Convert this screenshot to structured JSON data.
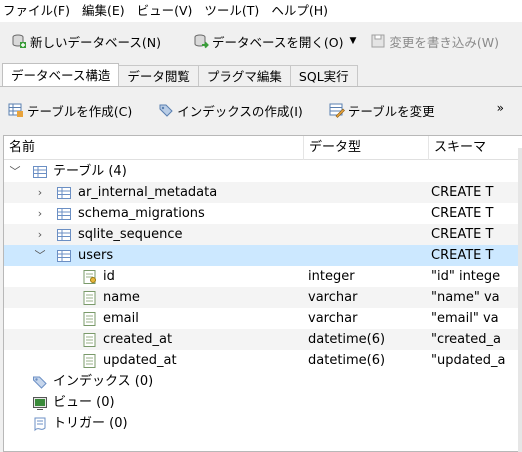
{
  "menu": [
    "ファイル(F)",
    "編集(E)",
    "ビュー(V)",
    "ツール(T)",
    "ヘルプ(H)"
  ],
  "toolbar": {
    "new_db": "新しいデータベース(N)",
    "open_db": "データベースを開く(O)",
    "write_changes": "変更を書き込み(W)"
  },
  "tabs": [
    "データベース構造",
    "データ閲覧",
    "プラグマ編集",
    "SQL実行"
  ],
  "subtoolbar": {
    "create_table": "テーブルを作成(C)",
    "create_index": "インデックスの作成(I)",
    "modify_table": "テーブルを変更",
    "more": "»"
  },
  "columns": {
    "name": "名前",
    "type": "データ型",
    "schema": "スキーマ"
  },
  "tree": {
    "tables_label": "テーブル (4)",
    "tables": [
      {
        "name": "ar_internal_metadata",
        "schema": "CREATE T"
      },
      {
        "name": "schema_migrations",
        "schema": "CREATE T"
      },
      {
        "name": "sqlite_sequence",
        "schema": "CREATE T"
      },
      {
        "name": "users",
        "schema": "CREATE T"
      }
    ],
    "fields": [
      {
        "name": "id",
        "type": "integer",
        "schema": "\"id\" intege"
      },
      {
        "name": "name",
        "type": "varchar",
        "schema": "\"name\" va"
      },
      {
        "name": "email",
        "type": "varchar",
        "schema": "\"email\" va"
      },
      {
        "name": "created_at",
        "type": "datetime(6)",
        "schema": "\"created_a"
      },
      {
        "name": "updated_at",
        "type": "datetime(6)",
        "schema": "\"updated_a"
      }
    ],
    "indexes_label": "インデックス (0)",
    "views_label": "ビュー (0)",
    "triggers_label": "トリガー (0)"
  },
  "colors": {
    "selection": "#cce8ff",
    "window_bg": "#f0f0f0"
  }
}
